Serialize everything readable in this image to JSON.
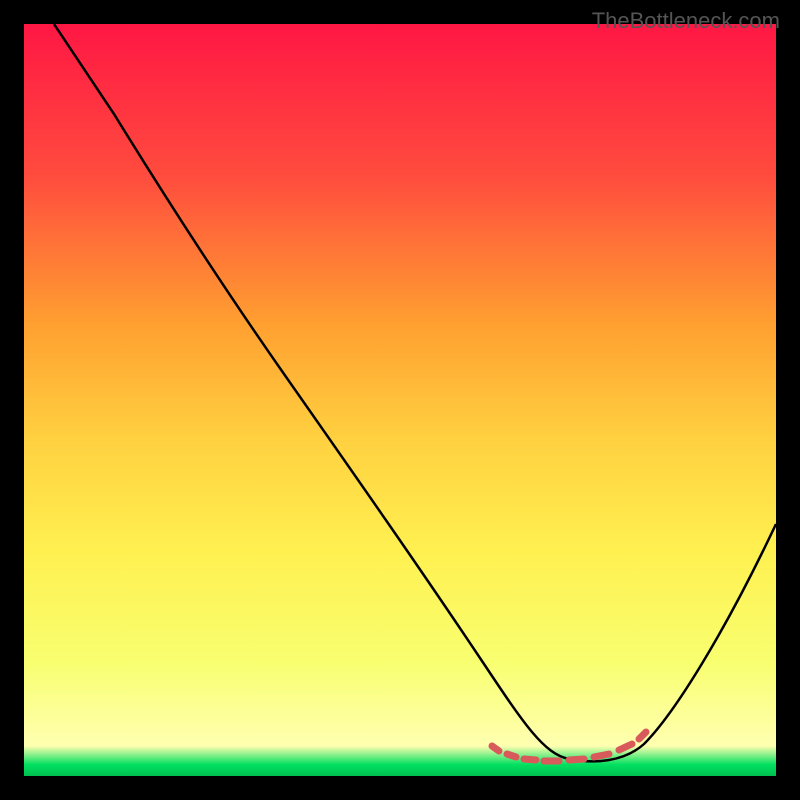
{
  "watermark": "TheBottleneck.com",
  "chart_data": {
    "type": "line",
    "title": "",
    "xlabel": "",
    "ylabel": "",
    "xlim": [
      0,
      100
    ],
    "ylim": [
      0,
      100
    ],
    "gradient_stops": [
      {
        "offset": 0,
        "color": "#ff1744"
      },
      {
        "offset": 20,
        "color": "#ff4b3e"
      },
      {
        "offset": 40,
        "color": "#ffa030"
      },
      {
        "offset": 55,
        "color": "#ffd040"
      },
      {
        "offset": 70,
        "color": "#fff050"
      },
      {
        "offset": 85,
        "color": "#f8ff70"
      },
      {
        "offset": 96,
        "color": "#ffffb0"
      },
      {
        "offset": 98.5,
        "color": "#00e060"
      },
      {
        "offset": 100,
        "color": "#00c050"
      }
    ],
    "series": [
      {
        "name": "bottleneck-curve",
        "color": "#000000",
        "x": [
          4,
          8,
          12,
          18,
          25,
          35,
          45,
          55,
          62,
          67,
          70,
          73,
          76,
          79,
          82,
          85,
          90,
          95,
          100
        ],
        "y": [
          100,
          95,
          89,
          80,
          70,
          56,
          42,
          28,
          18,
          10,
          6,
          3,
          2,
          2,
          3,
          6,
          14,
          24,
          34
        ]
      },
      {
        "name": "highlight-band",
        "color": "#e06060",
        "type": "scatter",
        "x": [
          62,
          65,
          68,
          71,
          73,
          75,
          77,
          79,
          81,
          83
        ],
        "y": [
          2.5,
          2.2,
          2.0,
          1.9,
          1.9,
          2.0,
          2.1,
          2.3,
          2.6,
          3.2
        ]
      }
    ]
  }
}
